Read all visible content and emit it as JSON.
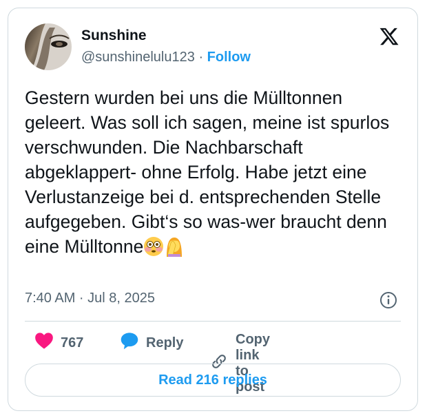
{
  "tweet": {
    "author_name": "Sunshine",
    "author_handle": "@sunshinelulu123",
    "separator": "·",
    "follow_label": "Follow",
    "text": "Gestern wurden bei uns die Mülltonnen geleert. Was soll ich sagen, meine ist spurlos verschwunden. Die Nachbarschaft abgeklappert- ohne Erfolg. Habe jetzt eine Verlustanzeige bei d. entsprechenden Stelle aufgegeben. Gibt‘s so was-wer braucht denn eine Mülltonne",
    "emojis": [
      "flushed-face",
      "woman-facepalming"
    ],
    "timestamp": "7:40 AM · Jul 8, 2025"
  },
  "actions": {
    "like_count": "767",
    "reply_label": "Reply",
    "copy_link_label": "Copy link to post"
  },
  "read_replies_label": "Read 216 replies",
  "colors": {
    "accent": "#1d9bf0",
    "like": "#f91880",
    "muted": "#536471",
    "border": "#cfd9de"
  }
}
